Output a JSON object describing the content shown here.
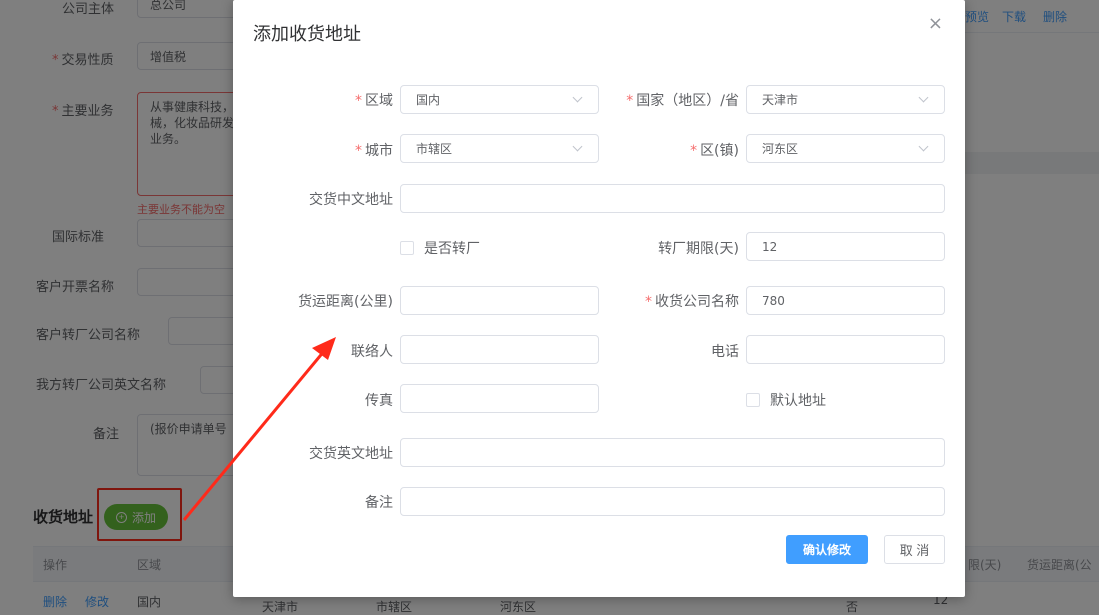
{
  "background": {
    "labels": {
      "company_subject": "公司主体",
      "trade_nature": "交易性质",
      "main_business": "主要业务",
      "intl_standard": "国际标准",
      "customer_invoice_name": "客户开票名称",
      "customer_transfer_company": "客户转厂公司名称",
      "our_transfer_company_en": "我方转厂公司英文名称",
      "remarks": "备注"
    },
    "values": {
      "company_subject": "总公司",
      "trade_nature": "增值税",
      "main_business": "从事健康科技，\n械，化妆品研发\n业务。",
      "remarks": "(报价申请单号"
    },
    "error_text": "主要业务不能为空",
    "top_links": [
      "预览",
      "下载",
      "删除"
    ],
    "section_title": "收货地址",
    "add_button": "添加",
    "table": {
      "headers": [
        "操作",
        "区域",
        "限(天)",
        "货运距离(公"
      ],
      "row": {
        "actions": [
          "删除",
          "修改"
        ],
        "region": "国内",
        "province": "天津市",
        "city": "市辖区",
        "district": "河东区",
        "transfer": "否",
        "days": "12"
      }
    }
  },
  "dialog": {
    "title": "添加收货地址",
    "close_icon": "×",
    "fields": {
      "region": {
        "label": "区域",
        "value": "国内",
        "required": true
      },
      "country_province": {
        "label": "国家（地区）/省",
        "value": "天津市",
        "required": true
      },
      "city": {
        "label": "城市",
        "value": "市辖区",
        "required": true
      },
      "district": {
        "label": "区(镇)",
        "value": "河东区",
        "required": true
      },
      "cn_address": {
        "label": "交货中文地址",
        "value": ""
      },
      "is_transfer": {
        "label": "是否转厂",
        "checked": false
      },
      "transfer_days": {
        "label": "转厂期限(天)",
        "value": "12"
      },
      "freight_distance": {
        "label": "货运距离(公里)",
        "value": ""
      },
      "receiving_company": {
        "label": "收货公司名称",
        "value": "780",
        "required": true
      },
      "contact": {
        "label": "联络人",
        "value": ""
      },
      "phone": {
        "label": "电话",
        "value": ""
      },
      "fax": {
        "label": "传真",
        "value": ""
      },
      "default_address": {
        "label": "默认地址",
        "checked": false
      },
      "en_address": {
        "label": "交货英文地址",
        "value": ""
      },
      "remark": {
        "label": "备注",
        "value": ""
      }
    },
    "required_mark": "*",
    "confirm_button": "确认修改",
    "cancel_button": "取 消"
  },
  "colors": {
    "primary": "#409eff",
    "success": "#67c23a",
    "danger": "#f56c6c",
    "annotation_red": "#ff2a1a"
  },
  "icons": {
    "add": "plus-circle-icon",
    "close": "close-icon",
    "select_arrow": "chevron-down-icon"
  }
}
